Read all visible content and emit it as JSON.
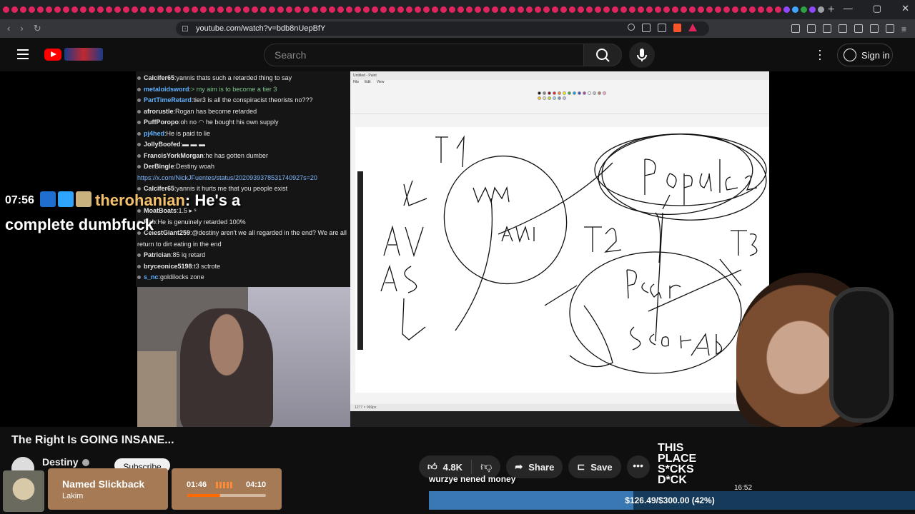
{
  "browser": {
    "url": "youtube.com/watch?v=bdb8nUepBfY",
    "tab_colors": [
      "#e0245e",
      "#e0245e",
      "#e0245e",
      "#e0245e",
      "#e0245e",
      "#e0245e",
      "#e0245e",
      "#e0245e",
      "#e0245e",
      "#e0245e",
      "#e0245e",
      "#e0245e",
      "#e0245e",
      "#e0245e",
      "#e0245e",
      "#e0245e",
      "#e0245e",
      "#e0245e",
      "#e0245e",
      "#e0245e",
      "#e0245e",
      "#e0245e",
      "#e0245e",
      "#e0245e",
      "#e0245e",
      "#e0245e",
      "#e0245e",
      "#e0245e",
      "#e0245e",
      "#e0245e",
      "#e0245e",
      "#e0245e",
      "#e0245e",
      "#e0245e",
      "#e0245e",
      "#e0245e",
      "#e0245e",
      "#e0245e",
      "#e0245e",
      "#e0245e",
      "#e0245e",
      "#e0245e",
      "#e0245e",
      "#e0245e",
      "#e0245e",
      "#e0245e",
      "#e0245e",
      "#e0245e",
      "#e0245e",
      "#e0245e",
      "#e0245e",
      "#e0245e",
      "#e0245e",
      "#e0245e",
      "#e0245e",
      "#e0245e",
      "#e0245e",
      "#e0245e",
      "#e0245e",
      "#e0245e",
      "#e0245e",
      "#e0245e",
      "#e0245e",
      "#e0245e",
      "#e0245e",
      "#e0245e",
      "#e0245e",
      "#e0245e",
      "#e0245e",
      "#e0245e",
      "#e0245e",
      "#e0245e",
      "#e0245e",
      "#e0245e",
      "#e0245e",
      "#e0245e",
      "#e0245e",
      "#e0245e",
      "#e0245e",
      "#e0245e",
      "#e0245e",
      "#e0245e",
      "#e0245e",
      "#e0245e",
      "#e0245e",
      "#e0245e",
      "#e0245e",
      "#e0245e",
      "#e0245e",
      "#e0245e",
      "#e0245e",
      "#9147ff",
      "#3ea6ff",
      "#2ea043",
      "#9147ff",
      "#9aa0a6",
      "#e0245e",
      "#e0245e",
      "#9aa0a6",
      "#9aa0a6",
      "#9aa0a6",
      "#f5c518",
      "#9aa0a6",
      "#9aa0a6",
      "#9aa0a6",
      "#9aa0a6",
      "#f5c518",
      "#9aa0a6",
      "#9aa0a6",
      "#9aa0a6"
    ]
  },
  "header": {
    "search_placeholder": "Search",
    "signin_label": "Sign in"
  },
  "overlay": {
    "time": "07:56",
    "username": "therohanian",
    "message_part1": ": He's a",
    "message_part2": "complete dumbfuck"
  },
  "chat": [
    {
      "user": "Calcifer65",
      "color": "#e6e6e6",
      "text": "yannis thats such a retarded thing to say"
    },
    {
      "user": "metaloidsword",
      "color": "#5fb2ff",
      "text": "> my aim is to become a tier 3",
      "text_color": "#7fc98f"
    },
    {
      "user": "PartTimeRetard",
      "color": "#5fb2ff",
      "text": "tier3 is all the conspiracist theorists no???"
    },
    {
      "user": "afrorustle",
      "color": "#e6e6e6",
      "text": "Rogan has become retarded"
    },
    {
      "user": "PuffPoropo",
      "color": "#e6e6e6",
      "text": "oh no ◠ he bought his own supply"
    },
    {
      "user": "pj4hed",
      "color": "#5fb2ff",
      "text": "He is paid to lie"
    },
    {
      "user": "JollyBoofed",
      "color": "#e6e6e6",
      "text": "▬ ▬ ▬"
    },
    {
      "user": "FrancisYorkMorgan",
      "color": "#e6e6e6",
      "text": "he has gotten dumber"
    },
    {
      "user": "DerBingle",
      "color": "#e6e6e6",
      "text": "Destiny woah"
    },
    {
      "user": "",
      "color": "#e6e6e6",
      "text": "https://x.com/NickJFuentes/status/2020939378531740927s=20",
      "link": true
    },
    {
      "user": "Calcifer65",
      "color": "#e6e6e6",
      "text": "yannis it hurts me that you people exist"
    },
    {
      "user": "",
      "color": "#e6e6e6",
      "text": ""
    },
    {
      "user": "MoatBoats",
      "color": "#e6e6e6",
      "text": "1.5 ▸ ˢ"
    },
    {
      "user": "Rab",
      "color": "#e6e6e6",
      "text": "He is genuinely retarded 100%"
    },
    {
      "user": "CelestGiant259",
      "color": "#e6e6e6",
      "text": "@destiny aren't we all regarded in the end? We are all return to dirt eating in the end",
      "wrap": true
    },
    {
      "user": "Patrician",
      "color": "#e6e6e6",
      "text": "85 iq retard"
    },
    {
      "user": "bryceonice5198",
      "color": "#e6e6e6",
      "text": "t3 sctrote"
    },
    {
      "user": "s_nc",
      "color": "#5fb2ff",
      "text": "goldilocks zone"
    }
  ],
  "paint": {
    "window_title": "Untitled - Paint",
    "menu": [
      "File",
      "Edit",
      "View"
    ],
    "status": "1277 × 969px",
    "swatch_colors": [
      "#000000",
      "#7f7f7f",
      "#880015",
      "#ed1c24",
      "#ff7f27",
      "#fff200",
      "#22b14c",
      "#00a2e8",
      "#3f48cc",
      "#a349a4",
      "#ffffff",
      "#c3c3c3",
      "#b97a57",
      "#ffaec9",
      "#ffc90e",
      "#efe4b0",
      "#b5e61d",
      "#99d9ea",
      "#7092be",
      "#c8bfe7"
    ]
  },
  "video": {
    "title": "The Right Is GOING INSANE...",
    "channel": "Destiny",
    "subscribe_label": "Subscribe",
    "likes": "4.8K",
    "share_label": "Share",
    "save_label": "Save"
  },
  "now_playing": {
    "song": "Named Slickback",
    "artist": "Lakim",
    "elapsed": "01:46",
    "total": "04:10",
    "progress_fraction": 0.42
  },
  "caption": "wurzye nened money",
  "goal": {
    "text": "$126.49/$300.00 (42%)",
    "fraction": 0.42
  },
  "sign": "THIS PLACE S*CKS D*CK",
  "clock": "16:52"
}
